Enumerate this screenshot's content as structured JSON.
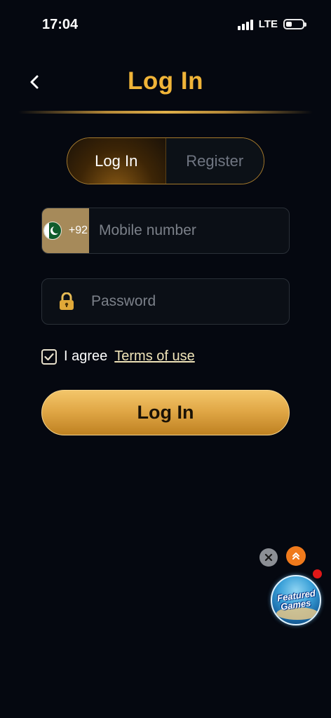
{
  "status_bar": {
    "time": "17:04",
    "network": "LTE"
  },
  "header": {
    "title": "Log In",
    "back_icon": "chevron-left-icon"
  },
  "tabs": [
    {
      "label": "Log In",
      "active": true
    },
    {
      "label": "Register",
      "active": false
    }
  ],
  "phone": {
    "country_flag": "pakistan-flag-icon",
    "country_code": "+92",
    "placeholder": "Mobile number",
    "value": ""
  },
  "password": {
    "icon": "lock-icon",
    "placeholder": "Password",
    "value": ""
  },
  "agree": {
    "checked": true,
    "text": "I agree",
    "link": "Terms of use"
  },
  "submit": {
    "label": "Log In"
  },
  "floating": {
    "close_icon": "close-icon",
    "up_icon": "double-chevron-up-icon",
    "featured_line1": "Featured",
    "featured_line2": "Games"
  },
  "colors": {
    "accent_gold": "#f0b438",
    "background": "#050810",
    "button_gold": "#e1a847",
    "notification_red": "#e01818",
    "up_orange": "#f07a1c"
  }
}
